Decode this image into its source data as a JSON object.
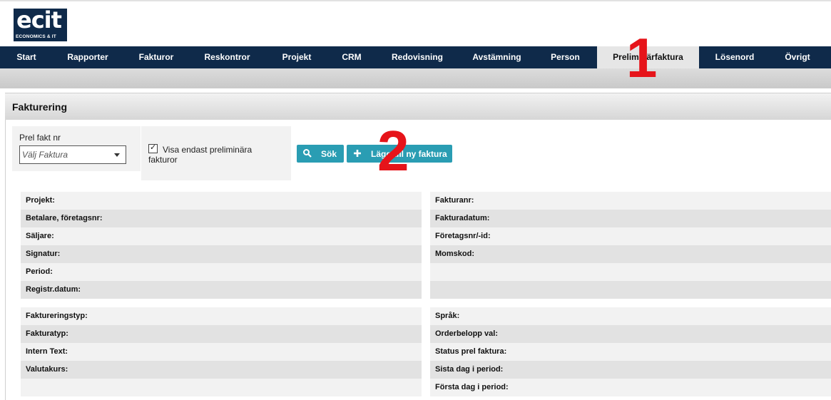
{
  "logo": {
    "main": "ecit",
    "sub": "ECONOMICS & IT"
  },
  "nav": {
    "items": [
      {
        "label": "Start"
      },
      {
        "label": "Rapporter"
      },
      {
        "label": "Fakturor"
      },
      {
        "label": "Reskontror"
      },
      {
        "label": "Projekt"
      },
      {
        "label": "CRM"
      },
      {
        "label": "Redovisning"
      },
      {
        "label": "Avstämning"
      },
      {
        "label": "Person"
      },
      {
        "label": "Preliminärfaktura",
        "active": true
      },
      {
        "label": "Lösenord"
      },
      {
        "label": "Övrigt"
      }
    ]
  },
  "annotations": {
    "one": "1",
    "two": "2"
  },
  "panel": {
    "title": "Fakturering"
  },
  "filter": {
    "prel_label": "Prel fakt nr",
    "select_placeholder": "Välj Faktura",
    "checkbox_label": "Visa endast preliminära fakturor",
    "checkbox_checked": true,
    "search_button": "Sök",
    "add_button": "Lägg till ny faktura"
  },
  "details": {
    "left_top": [
      "Projekt:",
      "Betalare, företagsnr:",
      "Säljare:",
      "Signatur:",
      "Period:",
      "Registr.datum:"
    ],
    "right_top": [
      "Fakturanr:",
      "Fakturadatum:",
      "Företagsnr/-id:",
      "Momskod:",
      "",
      ""
    ],
    "left_bottom": [
      "Faktureringstyp:",
      "Fakturatyp:",
      "Intern Text:",
      "Valutakurs:",
      ""
    ],
    "right_bottom": [
      "Språk:",
      "Orderbelopp val:",
      "Status prel faktura:",
      "Sista dag i period:",
      "Första dag i period:"
    ]
  },
  "colors": {
    "navy": "#0f2a4a",
    "teal": "#2a9db3",
    "red": "#e6141a"
  }
}
